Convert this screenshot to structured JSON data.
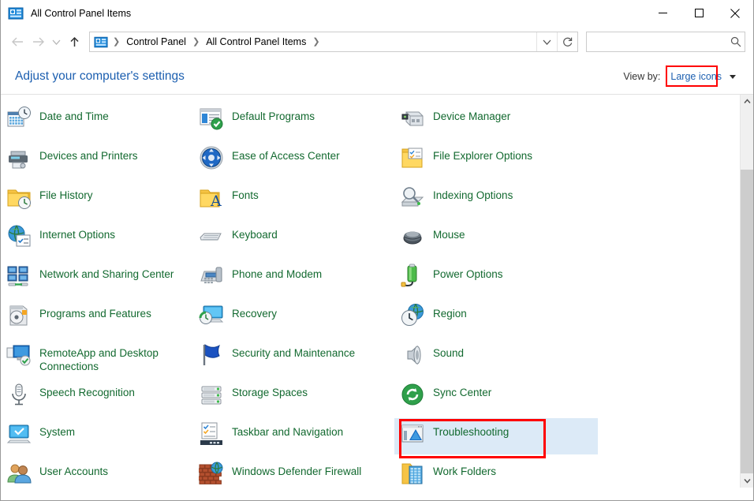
{
  "window": {
    "title": "All Control Panel Items",
    "title_icon": "control-panel-icon",
    "minimize_label": "Minimize",
    "maximize_label": "Maximize",
    "close_label": "Close"
  },
  "navbar": {
    "back_label": "Back",
    "forward_label": "Forward",
    "recent_label": "Recent locations",
    "up_label": "Up",
    "breadcrumbs": [
      "Control Panel",
      "All Control Panel Items"
    ],
    "dropdown_label": "Previous locations",
    "refresh_label": "Refresh",
    "search_value": "",
    "search_placeholder": ""
  },
  "header": {
    "adjust_title": "Adjust your computer's settings",
    "viewby_label": "View by:",
    "viewby_value": "Large icons",
    "viewby_highlight_color": "#ff0000"
  },
  "items": [
    {
      "label": "Date and Time",
      "icon": "date-and-time-icon",
      "col": 0,
      "row": 0
    },
    {
      "label": "Devices and Printers",
      "icon": "devices-and-printers-icon",
      "col": 0,
      "row": 1
    },
    {
      "label": "File History",
      "icon": "file-history-icon",
      "col": 0,
      "row": 2
    },
    {
      "label": "Internet Options",
      "icon": "internet-options-icon",
      "col": 0,
      "row": 3
    },
    {
      "label": "Network and Sharing Center",
      "icon": "network-and-sharing-center-icon",
      "col": 0,
      "row": 4
    },
    {
      "label": "Programs and Features",
      "icon": "programs-and-features-icon",
      "col": 0,
      "row": 5
    },
    {
      "label": "RemoteApp and Desktop Connections",
      "icon": "remoteapp-and-desktop-connections-icon",
      "col": 0,
      "row": 6
    },
    {
      "label": "Speech Recognition",
      "icon": "speech-recognition-icon",
      "col": 0,
      "row": 7
    },
    {
      "label": "System",
      "icon": "system-icon",
      "col": 0,
      "row": 8
    },
    {
      "label": "User Accounts",
      "icon": "user-accounts-icon",
      "col": 0,
      "row": 9
    },
    {
      "label": "Default Programs",
      "icon": "default-programs-icon",
      "col": 1,
      "row": 0
    },
    {
      "label": "Ease of Access Center",
      "icon": "ease-of-access-center-icon",
      "col": 1,
      "row": 1
    },
    {
      "label": "Fonts",
      "icon": "fonts-icon",
      "col": 1,
      "row": 2
    },
    {
      "label": "Keyboard",
      "icon": "keyboard-icon",
      "col": 1,
      "row": 3
    },
    {
      "label": "Phone and Modem",
      "icon": "phone-and-modem-icon",
      "col": 1,
      "row": 4
    },
    {
      "label": "Recovery",
      "icon": "recovery-icon",
      "col": 1,
      "row": 5
    },
    {
      "label": "Security and Maintenance",
      "icon": "security-and-maintenance-icon",
      "col": 1,
      "row": 6
    },
    {
      "label": "Storage Spaces",
      "icon": "storage-spaces-icon",
      "col": 1,
      "row": 7
    },
    {
      "label": "Taskbar and Navigation",
      "icon": "taskbar-and-navigation-icon",
      "col": 1,
      "row": 8
    },
    {
      "label": "Windows Defender Firewall",
      "icon": "windows-defender-firewall-icon",
      "col": 1,
      "row": 9
    },
    {
      "label": "Device Manager",
      "icon": "device-manager-icon",
      "col": 2,
      "row": 0
    },
    {
      "label": "File Explorer Options",
      "icon": "file-explorer-options-icon",
      "col": 2,
      "row": 1
    },
    {
      "label": "Indexing Options",
      "icon": "indexing-options-icon",
      "col": 2,
      "row": 2
    },
    {
      "label": "Mouse",
      "icon": "mouse-icon",
      "col": 2,
      "row": 3
    },
    {
      "label": "Power Options",
      "icon": "power-options-icon",
      "col": 2,
      "row": 4
    },
    {
      "label": "Region",
      "icon": "region-icon",
      "col": 2,
      "row": 5
    },
    {
      "label": "Sound",
      "icon": "sound-icon",
      "col": 2,
      "row": 6
    },
    {
      "label": "Sync Center",
      "icon": "sync-center-icon",
      "col": 2,
      "row": 7
    },
    {
      "label": "Troubleshooting",
      "icon": "troubleshooting-icon",
      "col": 2,
      "row": 8,
      "selected": true,
      "highlighted": true
    },
    {
      "label": "Work Folders",
      "icon": "work-folders-icon",
      "col": 2,
      "row": 9
    }
  ],
  "scrollbar": {
    "up_label": "Scroll up",
    "down_label": "Scroll down",
    "thumb_label": "Scroll thumb"
  },
  "colors": {
    "link_green": "#12692f",
    "link_blue": "#1c5fb0",
    "selection": "#dceaf7",
    "annotation_red": "#ff0000"
  }
}
